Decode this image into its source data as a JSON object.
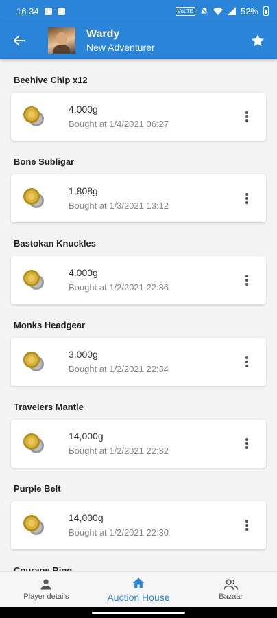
{
  "status_bar": {
    "time": "16:34",
    "battery": "52%",
    "volte_tag": "VoLTE"
  },
  "app_bar": {
    "name": "Wardy",
    "subtitle": "New Adventurer"
  },
  "items": [
    {
      "name": "Beehive Chip x12",
      "price": "4,000g",
      "bought": "Bought at 1/4/2021 06:27"
    },
    {
      "name": "Bone Subligar",
      "price": "1,808g",
      "bought": "Bought at 1/3/2021 13:12"
    },
    {
      "name": "Bastokan Knuckles",
      "price": "4,000g",
      "bought": "Bought at 1/2/2021 22:36"
    },
    {
      "name": "Monks Headgear",
      "price": "3,000g",
      "bought": "Bought at 1/2/2021 22:34"
    },
    {
      "name": "Travelers Mantle",
      "price": "14,000g",
      "bought": "Bought at 1/2/2021 22:32"
    },
    {
      "name": "Purple Belt",
      "price": "14,000g",
      "bought": "Bought at 1/2/2021 22:30"
    },
    {
      "name": "Courage Ring",
      "price": "",
      "bought": ""
    }
  ],
  "bottom_nav": [
    {
      "label": "Player details",
      "icon": "person-icon",
      "active": false
    },
    {
      "label": "Auction House",
      "icon": "home-icon",
      "active": true
    },
    {
      "label": "Bazaar",
      "icon": "people-icon",
      "active": false
    }
  ],
  "colors": {
    "primary": "#2a85d8",
    "background": "#f4f4f4",
    "card": "#ffffff",
    "coin": "#c9a227"
  }
}
